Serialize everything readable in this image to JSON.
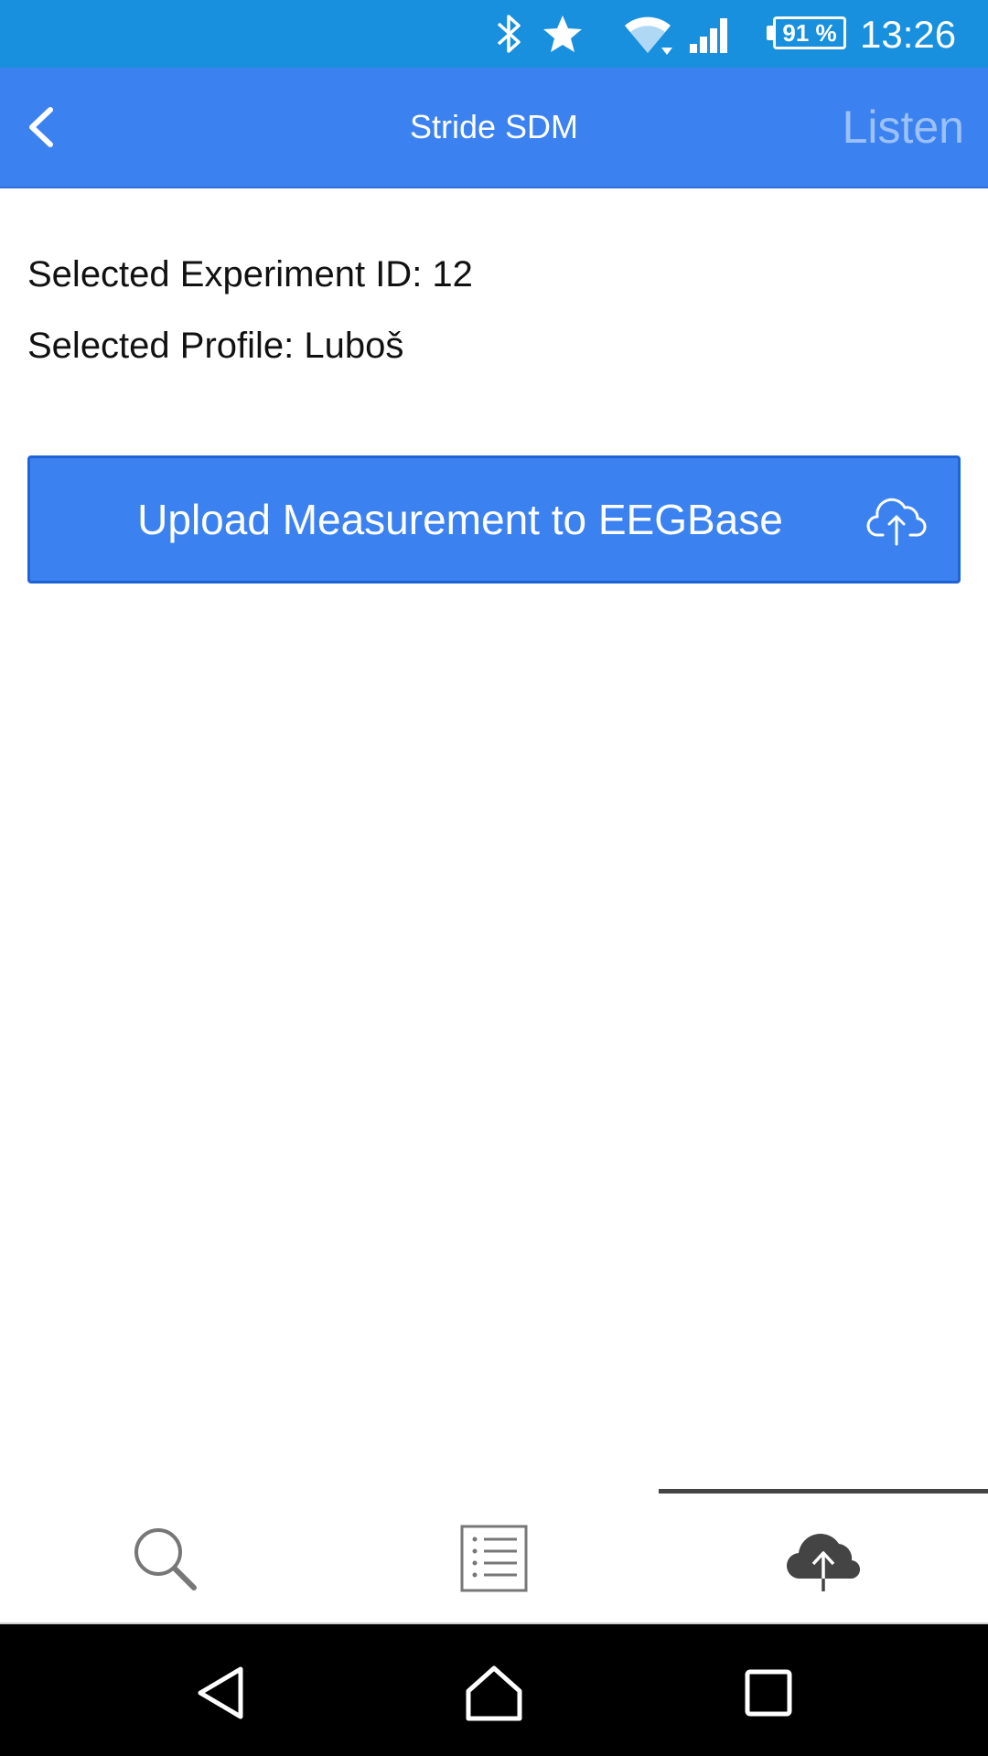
{
  "status_bar": {
    "icons": [
      "bluetooth-icon",
      "star-icon",
      "wifi-icon",
      "signal-icon"
    ],
    "battery": "91 %",
    "time": "13:26"
  },
  "app_bar": {
    "title": "Stride SDM",
    "back_icon": "chevron-left-icon",
    "action_label": "Listen"
  },
  "content": {
    "experiment_line": "Selected Experiment ID: 12",
    "profile_line": "Selected Profile: Luboš",
    "upload_button": {
      "label": "Upload Measurement to EEGBase",
      "icon": "cloud-upload-icon"
    }
  },
  "tabs": [
    {
      "icon": "search-icon",
      "selected": false
    },
    {
      "icon": "list-icon",
      "selected": false
    },
    {
      "icon": "cloud-upload-icon",
      "selected": true
    }
  ],
  "navigation_bar": [
    "back-icon",
    "home-icon",
    "recents-icon"
  ],
  "colors": {
    "status_bar": "#1890dd",
    "app_bar": "#3b82f0",
    "button": "#3b82f0",
    "listen_text": "#9cc0f8",
    "tab_indicator": "#444444"
  }
}
